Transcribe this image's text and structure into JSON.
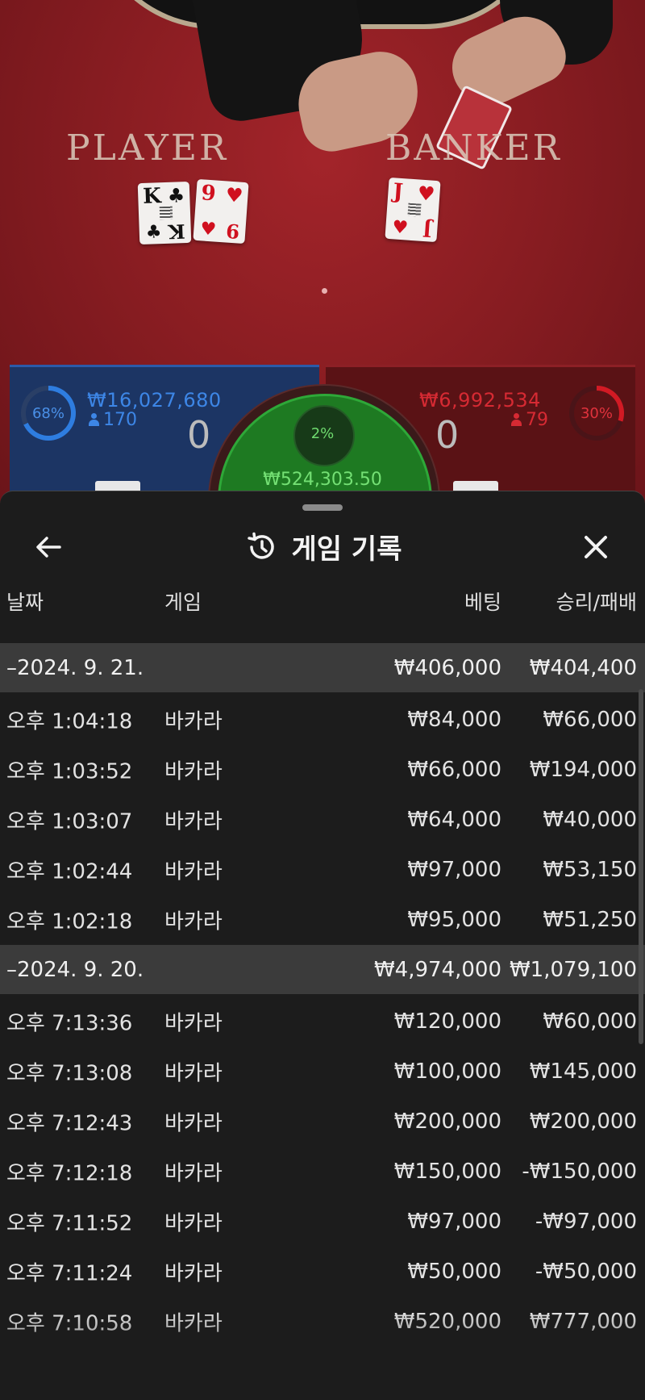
{
  "table": {
    "player_label": "PLAYER",
    "banker_label": "BANKER",
    "player_cards": [
      {
        "rank": "K",
        "suit": "♣",
        "color": "black"
      },
      {
        "rank": "9",
        "suit": "♥",
        "color": "red"
      }
    ],
    "banker_cards": [
      {
        "rank": "J",
        "suit": "♥",
        "color": "red"
      }
    ],
    "player": {
      "percent": "68%",
      "amount": "₩16,027,680",
      "players": "170",
      "score": "0",
      "color": "#2e7de0"
    },
    "banker": {
      "percent": "30%",
      "amount": "₩6,992,534",
      "players": "79",
      "score": "0",
      "color": "#d21a24"
    },
    "tie": {
      "percent": "2%",
      "amount": "₩524,303.50"
    }
  },
  "sheet": {
    "back_icon": "arrow-left-icon",
    "history_icon": "history-icon",
    "close_icon": "close-icon",
    "title": "게임 기록",
    "columns": {
      "date": "날짜",
      "game": "게임",
      "bet": "베팅",
      "result": "승리/패배"
    },
    "groups": [
      {
        "date": "–2024. 9. 21.",
        "bet": "₩406,000",
        "result": "₩404,400",
        "rows": [
          {
            "time": "오후 1:04:18",
            "game": "바카라",
            "bet": "₩84,000",
            "result": "₩66,000"
          },
          {
            "time": "오후 1:03:52",
            "game": "바카라",
            "bet": "₩66,000",
            "result": "₩194,000"
          },
          {
            "time": "오후 1:03:07",
            "game": "바카라",
            "bet": "₩64,000",
            "result": "₩40,000"
          },
          {
            "time": "오후 1:02:44",
            "game": "바카라",
            "bet": "₩97,000",
            "result": "₩53,150"
          },
          {
            "time": "오후 1:02:18",
            "game": "바카라",
            "bet": "₩95,000",
            "result": "₩51,250"
          }
        ]
      },
      {
        "date": "–2024. 9. 20.",
        "bet": "₩4,974,000",
        "result": "₩1,079,100",
        "rows": [
          {
            "time": "오후 7:13:36",
            "game": "바카라",
            "bet": "₩120,000",
            "result": "₩60,000"
          },
          {
            "time": "오후 7:13:08",
            "game": "바카라",
            "bet": "₩100,000",
            "result": "₩145,000"
          },
          {
            "time": "오후 7:12:43",
            "game": "바카라",
            "bet": "₩200,000",
            "result": "₩200,000"
          },
          {
            "time": "오후 7:12:18",
            "game": "바카라",
            "bet": "₩150,000",
            "result": "-₩150,000"
          },
          {
            "time": "오후 7:11:52",
            "game": "바카라",
            "bet": "₩97,000",
            "result": "-₩97,000"
          },
          {
            "time": "오후 7:11:24",
            "game": "바카라",
            "bet": "₩50,000",
            "result": "-₩50,000"
          },
          {
            "time": "오후 7:10:58",
            "game": "바카라",
            "bet": "₩520,000",
            "result": "₩777,000"
          }
        ]
      }
    ]
  }
}
